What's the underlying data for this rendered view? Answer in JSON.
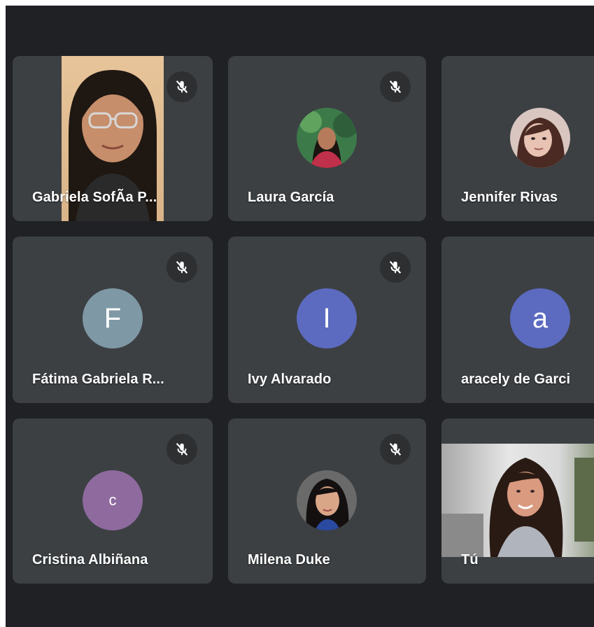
{
  "meeting": {
    "participants": [
      {
        "name": "Gabriela SofÃa P...",
        "muted": true,
        "display": "video"
      },
      {
        "name": "Laura García",
        "muted": true,
        "display": "photo"
      },
      {
        "name": "Jennifer Rivas",
        "muted": false,
        "display": "photo"
      },
      {
        "name": "Fátima Gabriela R...",
        "muted": true,
        "display": "letter",
        "initial": "F",
        "color": "#7e98a5"
      },
      {
        "name": "Ivy Alvarado",
        "muted": true,
        "display": "letter",
        "initial": "I",
        "color": "#5c6bc0"
      },
      {
        "name": "aracely de Garci",
        "muted": false,
        "display": "letter",
        "initial": "a",
        "color": "#5c6bc0"
      },
      {
        "name": "Cristina Albiñana",
        "muted": true,
        "display": "letter",
        "initial": "c",
        "color": "#8e6a9e"
      },
      {
        "name": "Milena Duke",
        "muted": true,
        "display": "photo"
      },
      {
        "name": "Tú",
        "muted": false,
        "display": "video"
      }
    ]
  },
  "icons": {
    "muted": "mic-off-icon"
  },
  "colors": {
    "background": "#202124",
    "tile": "#3c4043",
    "mic_badge": "#2d2f31",
    "text": "#ffffff"
  }
}
